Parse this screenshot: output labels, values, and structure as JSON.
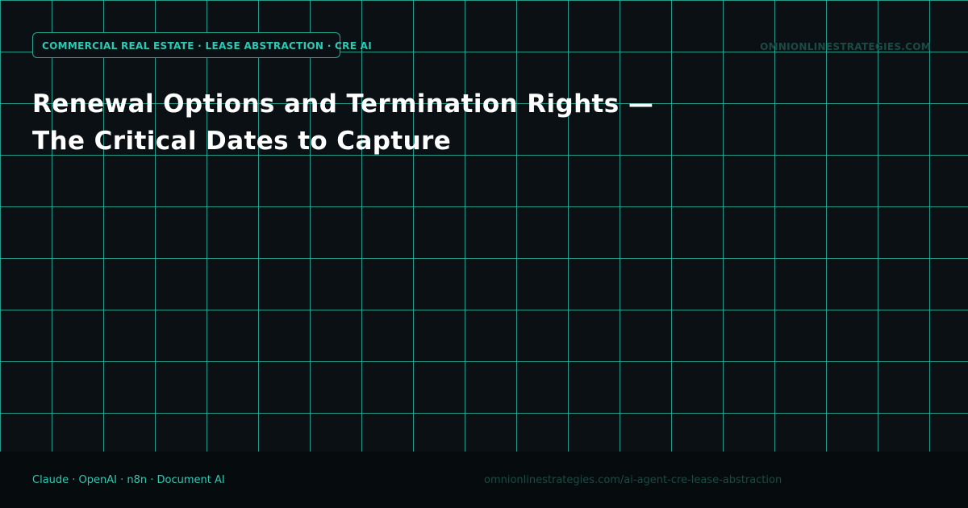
{
  "header": {
    "category_tag": "COMMERCIAL REAL ESTATE · LEASE ABSTRACTION · CRE AI",
    "site_brand": "OMNIONLINESTRATEGIES.COM"
  },
  "main": {
    "title_line_1": "Renewal Options and Termination Rights —",
    "title_line_2": "The Critical Dates to Capture"
  },
  "footer": {
    "tools": "Claude · OpenAI · n8n · Document AI",
    "url": "omnionlinestrategies.com/ai-agent-cre-lease-abstraction"
  },
  "colors": {
    "accent": "#2ec9b4",
    "background": "#0a1014",
    "footer_background": "#060b0e",
    "muted_text": "#1c4a44",
    "title_text": "#ffffff"
  }
}
